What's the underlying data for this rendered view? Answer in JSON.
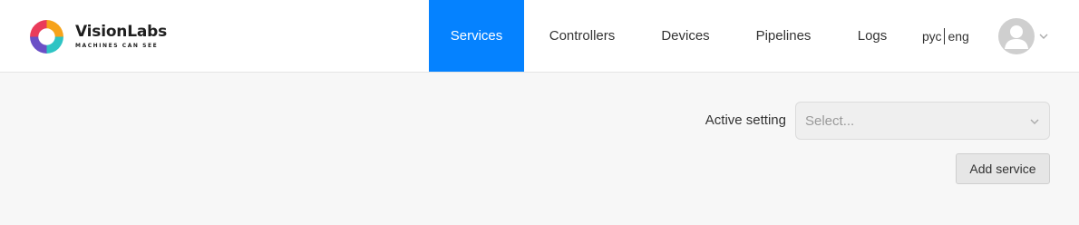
{
  "brand": {
    "name": "VisionLabs",
    "tagline": "MACHINES CAN SEE"
  },
  "nav": {
    "items": [
      {
        "label": "Services",
        "active": true
      },
      {
        "label": "Controllers",
        "active": false
      },
      {
        "label": "Devices",
        "active": false
      },
      {
        "label": "Pipelines",
        "active": false
      },
      {
        "label": "Logs",
        "active": false
      }
    ]
  },
  "language": {
    "ru": "рус",
    "en": "eng"
  },
  "user": {
    "avatar_icon": "user-avatar-icon",
    "menu_icon": "chevron-down-icon"
  },
  "settings": {
    "label": "Active setting",
    "select_placeholder": "Select..."
  },
  "actions": {
    "add_service": "Add service"
  },
  "colors": {
    "accent": "#0582ff",
    "background": "#f7f7f7",
    "header": "#ffffff"
  }
}
